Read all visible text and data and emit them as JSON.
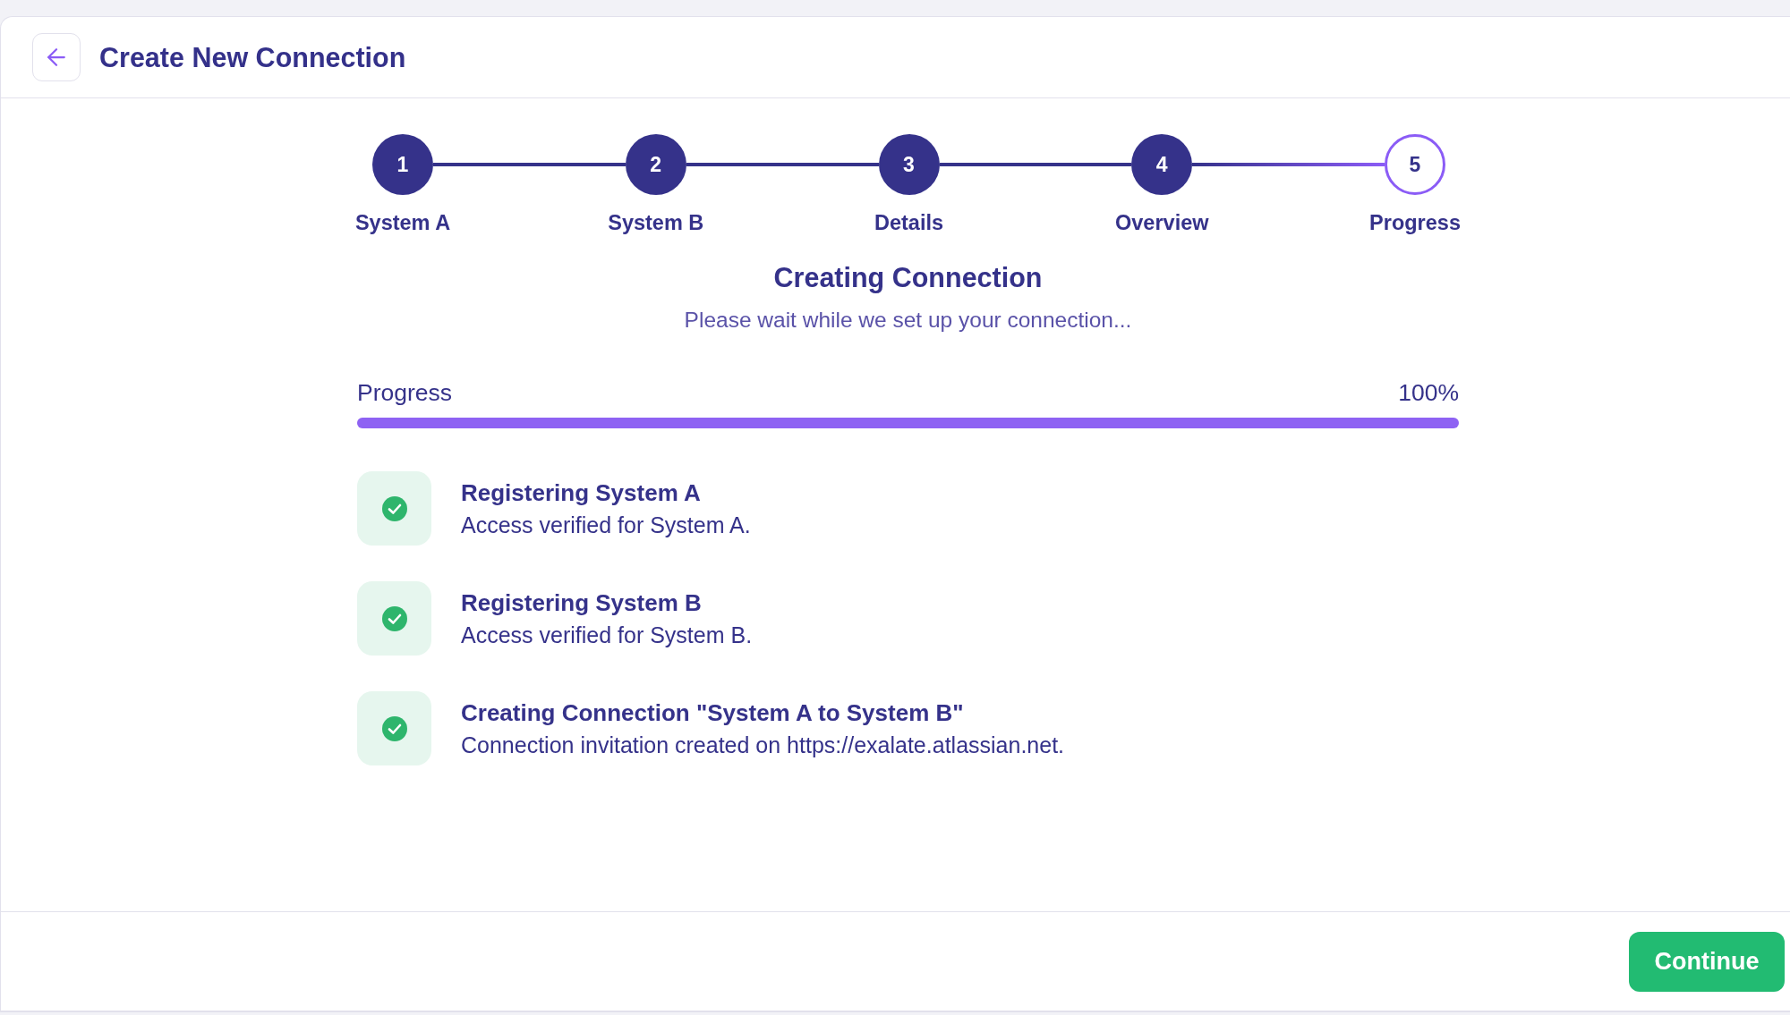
{
  "header": {
    "title": "Create New Connection"
  },
  "steps": [
    {
      "number": "1",
      "label": "System A",
      "completed": true
    },
    {
      "number": "2",
      "label": "System B",
      "completed": true
    },
    {
      "number": "3",
      "label": "Details",
      "completed": true
    },
    {
      "number": "4",
      "label": "Overview",
      "completed": true
    },
    {
      "number": "5",
      "label": "Progress",
      "completed": false
    }
  ],
  "status": {
    "title": "Creating Connection",
    "subtitle": "Please wait while we set up your connection..."
  },
  "progress": {
    "label": "Progress",
    "reading": "100%",
    "level": 1
  },
  "tasks": [
    {
      "title": "Registering System A",
      "description": "Access verified for System A.",
      "done": true
    },
    {
      "title": "Registering System B",
      "description": "Access verified for System B.",
      "done": true
    },
    {
      "title": "Creating Connection \"System A to System B\"",
      "description": "Connection invitation created on https://exalate.atlassian.net.",
      "done": true
    }
  ],
  "footer": {
    "buttons": [
      "Continue"
    ]
  }
}
